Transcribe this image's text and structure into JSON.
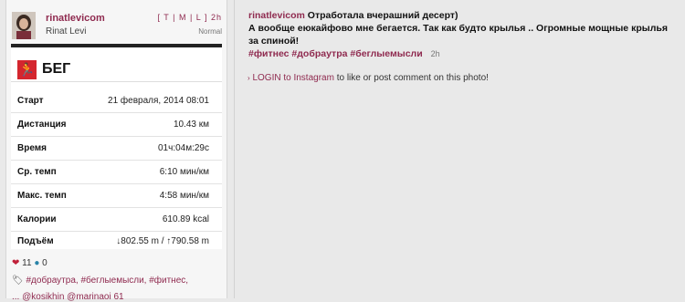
{
  "post": {
    "username": "rinatlevicom",
    "fullname": "Rinat Levi",
    "links": "[ T | M | L ]",
    "time": "2h",
    "filter": "Normal"
  },
  "workout": {
    "title": "БЕГ",
    "icon": "runner-icon",
    "accent": "#d4262e",
    "rows": [
      {
        "label": "Старт",
        "value": "21 февраля, 2014 08:01"
      },
      {
        "label": "Дистанция",
        "value": "10.43 км"
      },
      {
        "label": "Время",
        "value": "01ч:04м:29с"
      },
      {
        "label": "Ср. темп",
        "value": "6:10 мин/км"
      },
      {
        "label": "Макс. темп",
        "value": "4:58 мин/км"
      },
      {
        "label": "Калории",
        "value": "610.89 kcal"
      },
      {
        "label": "Подъём",
        "value": "↓802.55 m / ↑790.58 m"
      }
    ]
  },
  "stats": {
    "likes": "11",
    "comments": "0"
  },
  "tags_line": "#добраутра, #беглыемысли, #фитнес,",
  "tags_line2": "... @kosikhin @marinaoi 61",
  "caption": {
    "username": "rinatlevicom",
    "text": "Отработала вчерашний десерт)\nА вообще еюкайфово мне бегается. Так как будто крылья .. Огромные мощные крылья за спиной!",
    "hashtags": "#фитнес #добраутра #беглыемысли",
    "time": "2h"
  },
  "login": {
    "link": "LOGIN to Instagram",
    "rest": " to like or post comment on this photo!"
  },
  "colors": {
    "brand": "#8f2a4f",
    "heart": "#c0213a",
    "comment": "#2a84a8"
  }
}
